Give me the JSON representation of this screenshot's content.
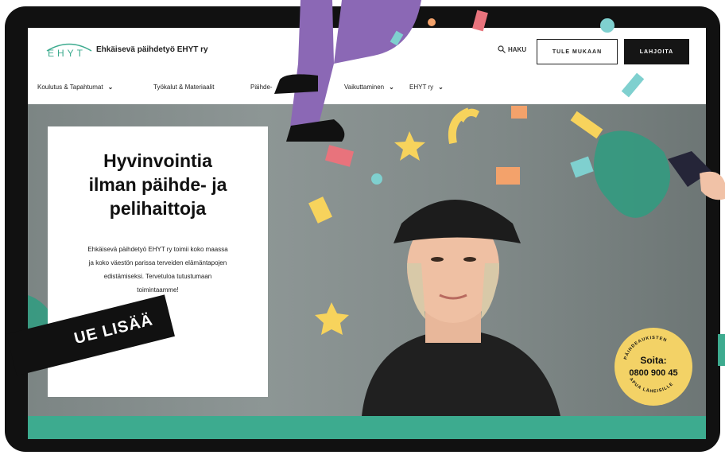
{
  "header": {
    "logo_text": "EHYT",
    "org_name": "Ehkäisevä päihdetyö EHYT ry",
    "search_label": "HAKU",
    "outline_button": "TULE MUKAAN",
    "dark_button": "LAHJOITA"
  },
  "nav": {
    "items": [
      {
        "label": "Koulutus & Tapahtumat"
      },
      {
        "label": "Työkalut & Materiaalit"
      },
      {
        "label": "Päihde-"
      },
      {
        "label": "Vaikuttaminen"
      },
      {
        "label": "EHYT ry"
      }
    ]
  },
  "hero": {
    "headline_line1": "Hyvinvointia",
    "headline_line2": "ilman päihde- ja",
    "headline_line3": "pelihaittoja",
    "lead_line1": "Ehkäisevä päihdetyö EHYT ry toimii koko maassa",
    "lead_line2": "ja koko väestön parissa terveiden elämäntapojen",
    "lead_line3": "edistämiseksi. Tervetuloa tutustumaan",
    "lead_line4": "toimintaamme!"
  },
  "badge": {
    "arc_top": "PÄIHDEAUKISTEN",
    "label": "Soita:",
    "number": "0800 900 45",
    "arc_bottom": "APUA LÄHEISILLE"
  },
  "ribbon": {
    "text": "UE LISÄÄ"
  },
  "colors": {
    "frame": "#111111",
    "accent_green": "#3dab8f",
    "badge_yellow": "#f3d266",
    "confetti_pink": "#e8737c",
    "confetti_yellow": "#f7d35c",
    "confetti_teal": "#7fd0cf",
    "confetti_orange": "#f3a26b",
    "figure_purple": "#8b68b5"
  }
}
